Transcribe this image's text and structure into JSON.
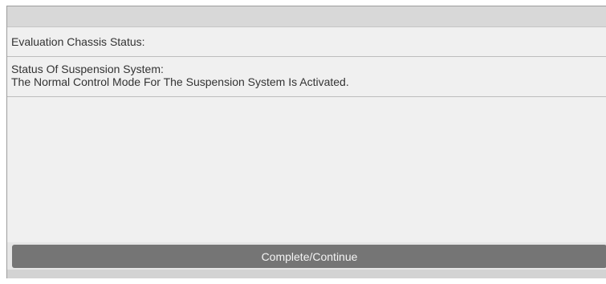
{
  "status_list": {
    "evaluation_label": "Evaluation Chassis Status:",
    "suspension_heading": "Status Of Suspension System:",
    "suspension_detail": "The Normal Control Mode For The Suspension System Is Activated."
  },
  "footer": {
    "complete_button_label": "Complete/Continue"
  },
  "colors": {
    "button_bg": "#757575",
    "title_bar_bg": "#d8d8d8",
    "content_bg": "#f0f0f0"
  }
}
